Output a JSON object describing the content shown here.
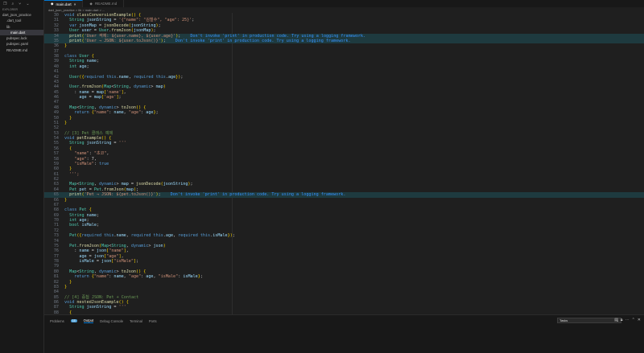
{
  "sidebar": {
    "header": "EXPLORER",
    "items": [
      {
        "label": "dart_json_practice",
        "level": 0
      },
      {
        "label": ".dart_tool",
        "level": 1
      },
      {
        "label": "lib",
        "level": 1
      },
      {
        "label": "main.dart",
        "level": 2,
        "selected": true
      },
      {
        "label": "pubspec.lock",
        "level": 1
      },
      {
        "label": "pubspec.yaml",
        "level": 1
      },
      {
        "label": "README.md",
        "level": 1
      }
    ]
  },
  "tabs": [
    {
      "label": "main.dart",
      "active": true
    },
    {
      "label": "README.md",
      "active": false
    }
  ],
  "breadcrumb": "dart_json_practice > lib > main.dart > ...",
  "diagnostic": "Don't invoke 'print' in production code. Try using a logging framework.",
  "lines": [
    {
      "n": 30,
      "t": "void classConversionExample() {"
    },
    {
      "n": 31,
      "t": "  String jsonString = '{\"name\": \"김철수\", \"age\": 25}';"
    },
    {
      "n": 32,
      "t": "  var jsonMap = jsonDecode(jsonString);"
    },
    {
      "n": 33,
      "t": "  User user = User.fromJson(jsonMap);"
    },
    {
      "n": 34,
      "t": "  print('User 객체: ${user.name}, ${user.age}');",
      "w": true
    },
    {
      "n": 35,
      "t": "  print('User → JSON: ${user.toJson()}');",
      "w": true
    },
    {
      "n": 36,
      "t": "}"
    },
    {
      "n": 37,
      "t": ""
    },
    {
      "n": 38,
      "t": "class User {"
    },
    {
      "n": 39,
      "t": "  String name;"
    },
    {
      "n": 40,
      "t": "  int age;"
    },
    {
      "n": 41,
      "t": ""
    },
    {
      "n": 42,
      "t": "  User({required this.name, required this.age});"
    },
    {
      "n": 43,
      "t": ""
    },
    {
      "n": 44,
      "t": "  User.fromJson(Map<String, dynamic> map)"
    },
    {
      "n": 45,
      "t": "    : name = map['name'],"
    },
    {
      "n": 46,
      "t": "      age = map['age'];"
    },
    {
      "n": 47,
      "t": ""
    },
    {
      "n": 48,
      "t": "  Map<String, dynamic> toJson() {"
    },
    {
      "n": 49,
      "t": "    return {\"name\": name, \"age\": age};"
    },
    {
      "n": 50,
      "t": "  }"
    },
    {
      "n": 51,
      "t": "}"
    },
    {
      "n": 52,
      "t": ""
    },
    {
      "n": 53,
      "t": "// [3] Pet 클래스 예제"
    },
    {
      "n": 54,
      "t": "void petExample() {"
    },
    {
      "n": 55,
      "t": "  String jsonString = '''"
    },
    {
      "n": 56,
      "t": "  {"
    },
    {
      "n": 57,
      "t": "    \"name\": \"초코\","
    },
    {
      "n": 58,
      "t": "    \"age\": 7,"
    },
    {
      "n": 59,
      "t": "    \"isMale\": true"
    },
    {
      "n": 60,
      "t": "  }"
    },
    {
      "n": 61,
      "t": "  ''';"
    },
    {
      "n": 62,
      "t": ""
    },
    {
      "n": 63,
      "t": "  Map<String, dynamic> map = jsonDecode(jsonString);"
    },
    {
      "n": 64,
      "t": "  Pet pet = Pet.fromJson(map);"
    },
    {
      "n": 65,
      "t": "  print('Pet → JSON: ${pet.toJson()}');",
      "w": true
    },
    {
      "n": 66,
      "t": "}"
    },
    {
      "n": 67,
      "t": ""
    },
    {
      "n": 68,
      "t": "class Pet {"
    },
    {
      "n": 69,
      "t": "  String name;"
    },
    {
      "n": 70,
      "t": "  int age;"
    },
    {
      "n": 71,
      "t": "  bool isMale;"
    },
    {
      "n": 72,
      "t": ""
    },
    {
      "n": 73,
      "t": "  Pet({required this.name, required this.age, required this.isMale});"
    },
    {
      "n": 74,
      "t": ""
    },
    {
      "n": 75,
      "t": "  Pet.fromJson(Map<String, dynamic> json)"
    },
    {
      "n": 76,
      "t": "    : name = json[\"name\"],"
    },
    {
      "n": 77,
      "t": "      age = json[\"age\"],"
    },
    {
      "n": 78,
      "t": "      isMale = json[\"isMale\"];"
    },
    {
      "n": 79,
      "t": ""
    },
    {
      "n": 80,
      "t": "  Map<String, dynamic> toJson() {"
    },
    {
      "n": 81,
      "t": "    return {\"name\": name, \"age\": age, \"isMale\": isMale};"
    },
    {
      "n": 82,
      "t": "  }"
    },
    {
      "n": 83,
      "t": "}"
    },
    {
      "n": 84,
      "t": ""
    },
    {
      "n": 85,
      "t": "// [4] 중첩 JSON: Pet + Contact"
    },
    {
      "n": 86,
      "t": "void nestedJsonExample() {"
    },
    {
      "n": 87,
      "t": "  String jsonString = '''"
    },
    {
      "n": 88,
      "t": "  {"
    }
  ],
  "panel": {
    "tabs": [
      "Problems",
      "Output",
      "Debug Console",
      "Terminal",
      "Ports"
    ],
    "active": "Output",
    "problems_count": "15",
    "task_select": "Tasks"
  }
}
